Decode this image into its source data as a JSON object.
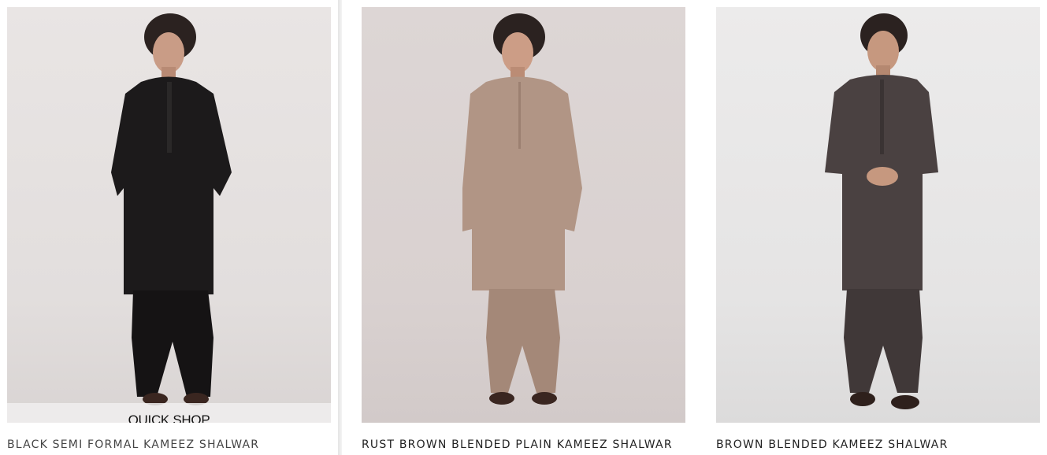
{
  "products": [
    {
      "name": "BLACK SEMI FORMAL KAMEEZ SHALWAR",
      "quick_shop_label": "QUICK SHOP",
      "garment_color": "#1c1a1b",
      "image_icon": "model-in-black-kameez-shalwar"
    },
    {
      "name": "RUST BROWN BLENDED PLAIN KAMEEZ SHALWAR",
      "garment_color": "#b19585",
      "image_icon": "model-in-rust-brown-kameez-shalwar"
    },
    {
      "name": "BROWN BLENDED KAMEEZ SHALWAR",
      "garment_color": "#4a4141",
      "image_icon": "model-in-brown-kameez-shalwar"
    }
  ]
}
